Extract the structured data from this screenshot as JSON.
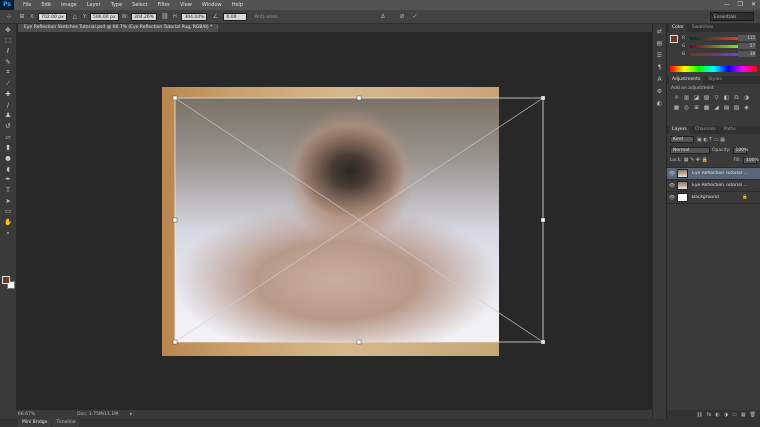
{
  "app": {
    "logo": "Ps"
  },
  "menu": [
    "File",
    "Edit",
    "Image",
    "Layer",
    "Type",
    "Select",
    "Filter",
    "View",
    "Window",
    "Help"
  ],
  "window_controls": {
    "minimize": "—",
    "restore": "❐",
    "close": "✕"
  },
  "options": {
    "x_label": "X:",
    "x_value": "702.00 px",
    "y_label": "Y:",
    "y_value": "506.00 px",
    "w_label": "W:",
    "w_value": "304.26%",
    "h_label": "H:",
    "h_value": "304.04%",
    "angle_value": "0.00",
    "interp_label": "Anti-alias",
    "workspace": "Essentials"
  },
  "document_tab": {
    "title": "Eye Reflection Sketches Tutorial.psd @ 66.7% (Eye Reflection Tutorial Pug, RGB/8) *",
    "close": "×"
  },
  "tools": [
    {
      "name": "move-tool",
      "glyph": "✥"
    },
    {
      "name": "marquee-tool",
      "glyph": "⬚"
    },
    {
      "name": "lasso-tool",
      "glyph": "ℓ"
    },
    {
      "name": "quick-select-tool",
      "glyph": "✎"
    },
    {
      "name": "crop-tool",
      "glyph": "⌗"
    },
    {
      "name": "eyedropper-tool",
      "glyph": "⁄"
    },
    {
      "name": "healing-tool",
      "glyph": "✚"
    },
    {
      "name": "brush-tool",
      "glyph": "/"
    },
    {
      "name": "clone-stamp-tool",
      "glyph": "♟"
    },
    {
      "name": "history-brush-tool",
      "glyph": "↺"
    },
    {
      "name": "eraser-tool",
      "glyph": "▱"
    },
    {
      "name": "gradient-tool",
      "glyph": "▮"
    },
    {
      "name": "blur-tool",
      "glyph": "●"
    },
    {
      "name": "dodge-tool",
      "glyph": "◖"
    },
    {
      "name": "pen-tool",
      "glyph": "✒"
    },
    {
      "name": "type-tool",
      "glyph": "T"
    },
    {
      "name": "path-select-tool",
      "glyph": "➤"
    },
    {
      "name": "shape-tool",
      "glyph": "▭"
    },
    {
      "name": "hand-tool",
      "glyph": "✋"
    },
    {
      "name": "zoom-tool",
      "glyph": "⌕"
    }
  ],
  "status": {
    "zoom": "66.67%",
    "doc": "Doc: 3.75M/11.1M"
  },
  "bottom_tabs": [
    "Mini Bridge",
    "Timeline"
  ],
  "panel_strip": [
    "⇄",
    "▤",
    "☰",
    "¶",
    "A",
    "⚙",
    "◐"
  ],
  "color_panel": {
    "tabs": [
      "Color",
      "Swatches"
    ],
    "r_label": "R",
    "r_value": "115",
    "g_label": "G",
    "g_value": "57",
    "b_label": "B",
    "b_value": "38",
    "fg": "#6a3a22"
  },
  "adjustments_panel": {
    "tabs": [
      "Adjustments",
      "Styles"
    ],
    "hint": "Add an adjustment",
    "icons": [
      "☼",
      "▥",
      "◪",
      "▨",
      "▽",
      "◧",
      "⚖",
      "◑",
      "▦",
      "◎",
      "⊞",
      "▩",
      "◢",
      "▤",
      "▧",
      "◈"
    ]
  },
  "layers_panel": {
    "tabs": [
      "Layers",
      "Channels",
      "Paths"
    ],
    "kind": "Kind",
    "blend_mode": "Normal",
    "opacity_label": "Opacity:",
    "opacity_value": "100%",
    "lock_label": "Lock:",
    "fill_label": "Fill:",
    "fill_value": "100%",
    "layers": [
      {
        "name": "Eye Reflection Tutorial ...",
        "selected": true
      },
      {
        "name": "Eye Reflection Tutorial ...",
        "selected": false
      },
      {
        "name": "Background",
        "selected": false
      }
    ],
    "footer_icons": [
      "⛓",
      "fx",
      "◐",
      "◑",
      "▭",
      "▦",
      "🗑"
    ]
  }
}
